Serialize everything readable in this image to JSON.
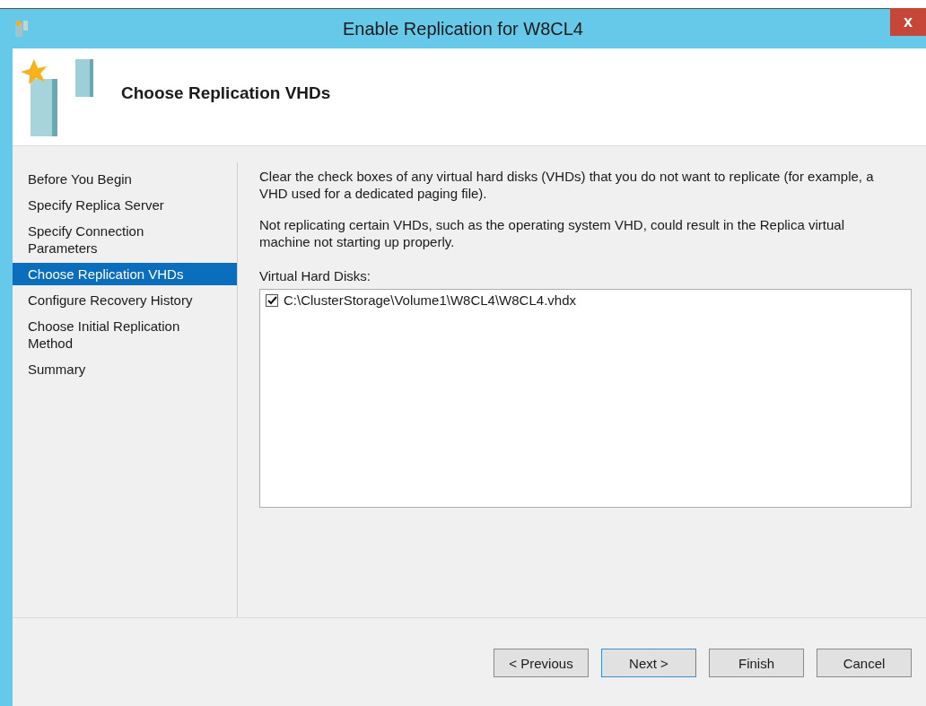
{
  "window": {
    "title": "Enable Replication for W8CL4",
    "close": "x"
  },
  "header": {
    "title": "Choose Replication VHDs"
  },
  "sidebar": {
    "items": [
      {
        "label": "Before You Begin",
        "selected": false
      },
      {
        "label": "Specify Replica Server",
        "selected": false
      },
      {
        "label": "Specify Connection Parameters",
        "selected": false
      },
      {
        "label": "Choose Replication VHDs",
        "selected": true
      },
      {
        "label": "Configure Recovery History",
        "selected": false
      },
      {
        "label": "Choose Initial Replication Method",
        "selected": false
      },
      {
        "label": "Summary",
        "selected": false
      }
    ]
  },
  "content": {
    "paragraphs": [
      "Clear the check boxes of any virtual hard disks (VHDs) that you do not want to replicate (for example, a VHD used for a dedicated paging file).",
      "Not replicating certain VHDs, such as the operating system VHD, could result in the Replica virtual machine not starting up properly."
    ],
    "list_label": "Virtual Hard Disks:",
    "disks": [
      {
        "path": "C:\\ClusterStorage\\Volume1\\W8CL4\\W8CL4.vhdx",
        "checked": true
      }
    ]
  },
  "buttons": [
    {
      "label": "< Previous",
      "default": false
    },
    {
      "label": "Next >",
      "default": true
    },
    {
      "label": "Finish",
      "default": false
    },
    {
      "label": "Cancel",
      "default": false
    }
  ]
}
